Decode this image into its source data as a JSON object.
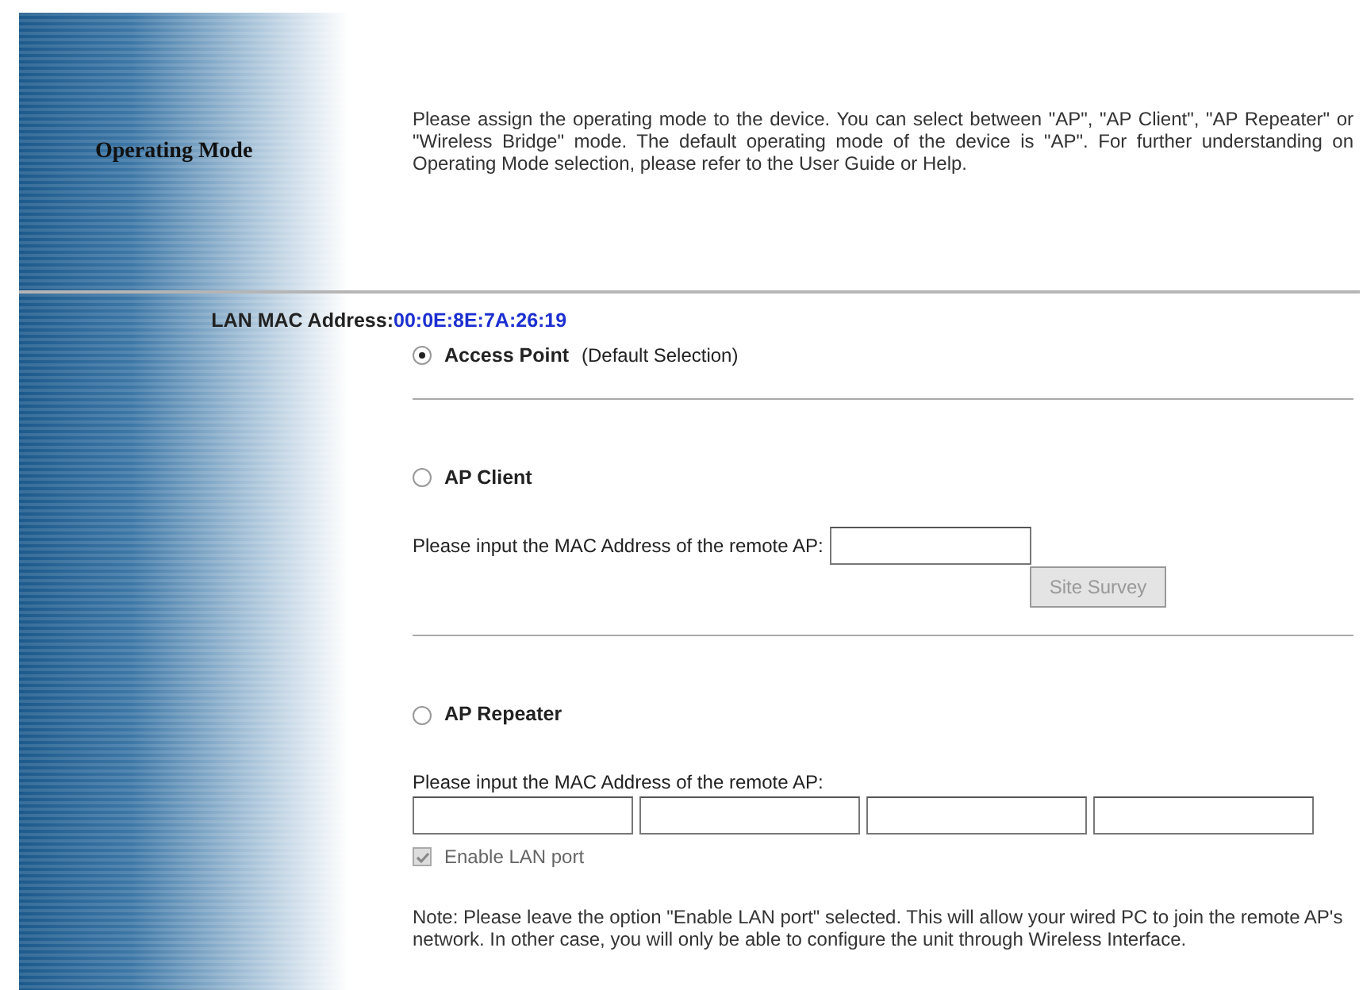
{
  "header": {
    "title": "Operating Mode",
    "description": "Please assign the operating mode to the device. You can select between \"AP\", \"AP Client\", \"AP Repeater\" or \"Wireless Bridge\" mode. The default operating mode of the device is \"AP\". For further understanding on Operating Mode selection, please refer to the User Guide or Help."
  },
  "lan_mac": {
    "label": "LAN MAC Address:",
    "value": "00:0E:8E:7A:26:19"
  },
  "modes": [
    {
      "kind": "plain",
      "label": "Access Point",
      "suffix": "(Default Selection)",
      "selected": true
    },
    {
      "kind": "client",
      "label": "AP Client",
      "selected": false,
      "prompt": "Please input the MAC Address of the remote AP:",
      "button": {
        "label": "Site Survey",
        "disabled": true
      }
    },
    {
      "kind": "repeater",
      "label": "AP Repeater",
      "selected": false,
      "prompt": "Please input the MAC Address of the remote AP:",
      "checkbox": {
        "label": "Enable LAN port",
        "checked": true,
        "disabled": true
      },
      "note": "Note: Please leave the option \"Enable LAN port\" selected. This will allow your wired PC to join the remote AP's network. In other case, you will only be able to configure the unit through Wireless Interface."
    }
  ]
}
